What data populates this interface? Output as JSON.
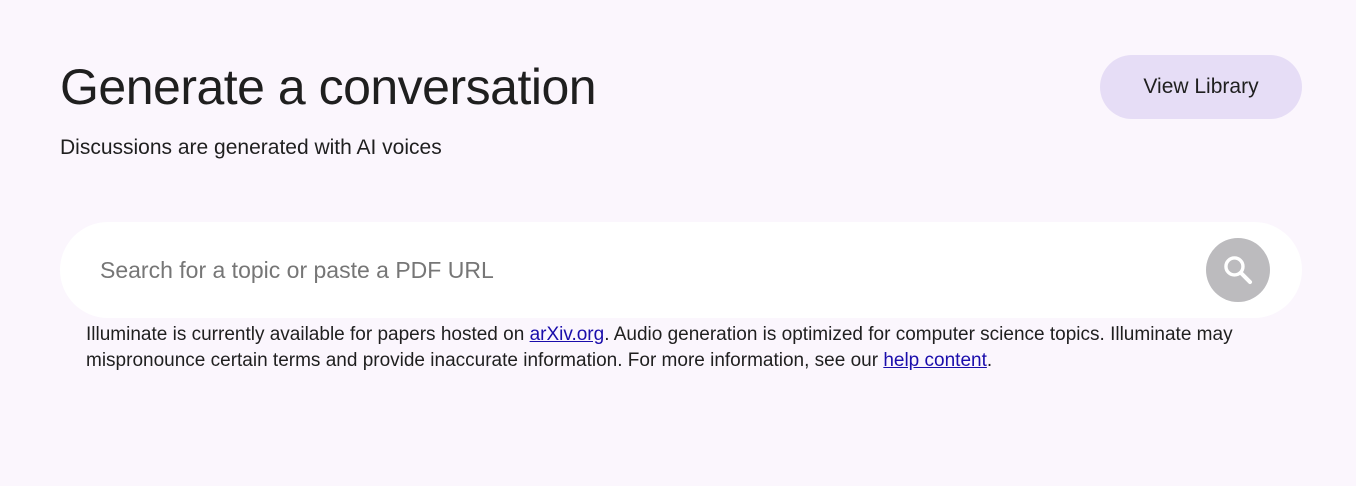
{
  "header": {
    "title": "Generate a conversation",
    "subtitle": "Discussions are generated with AI voices",
    "library_button_label": "View Library"
  },
  "search": {
    "placeholder": "Search for a topic or paste a PDF URL",
    "value": "",
    "button_icon": "search-icon"
  },
  "disclaimer": {
    "text_before_link": "Illuminate is currently available for papers hosted on ",
    "arxiv_link": "arXiv.org",
    "text_middle": ". Audio generation is optimized for computer science topics. Illuminate may mispronounce certain terms and provide inaccurate information. For more information, see our ",
    "help_link": "help content",
    "text_after_link": "."
  },
  "colors": {
    "background": "#fbf6fd",
    "library_button_bg": "#e6ddf6",
    "search_button_bg": "#bcbbbe",
    "link": "#1a0dab"
  }
}
